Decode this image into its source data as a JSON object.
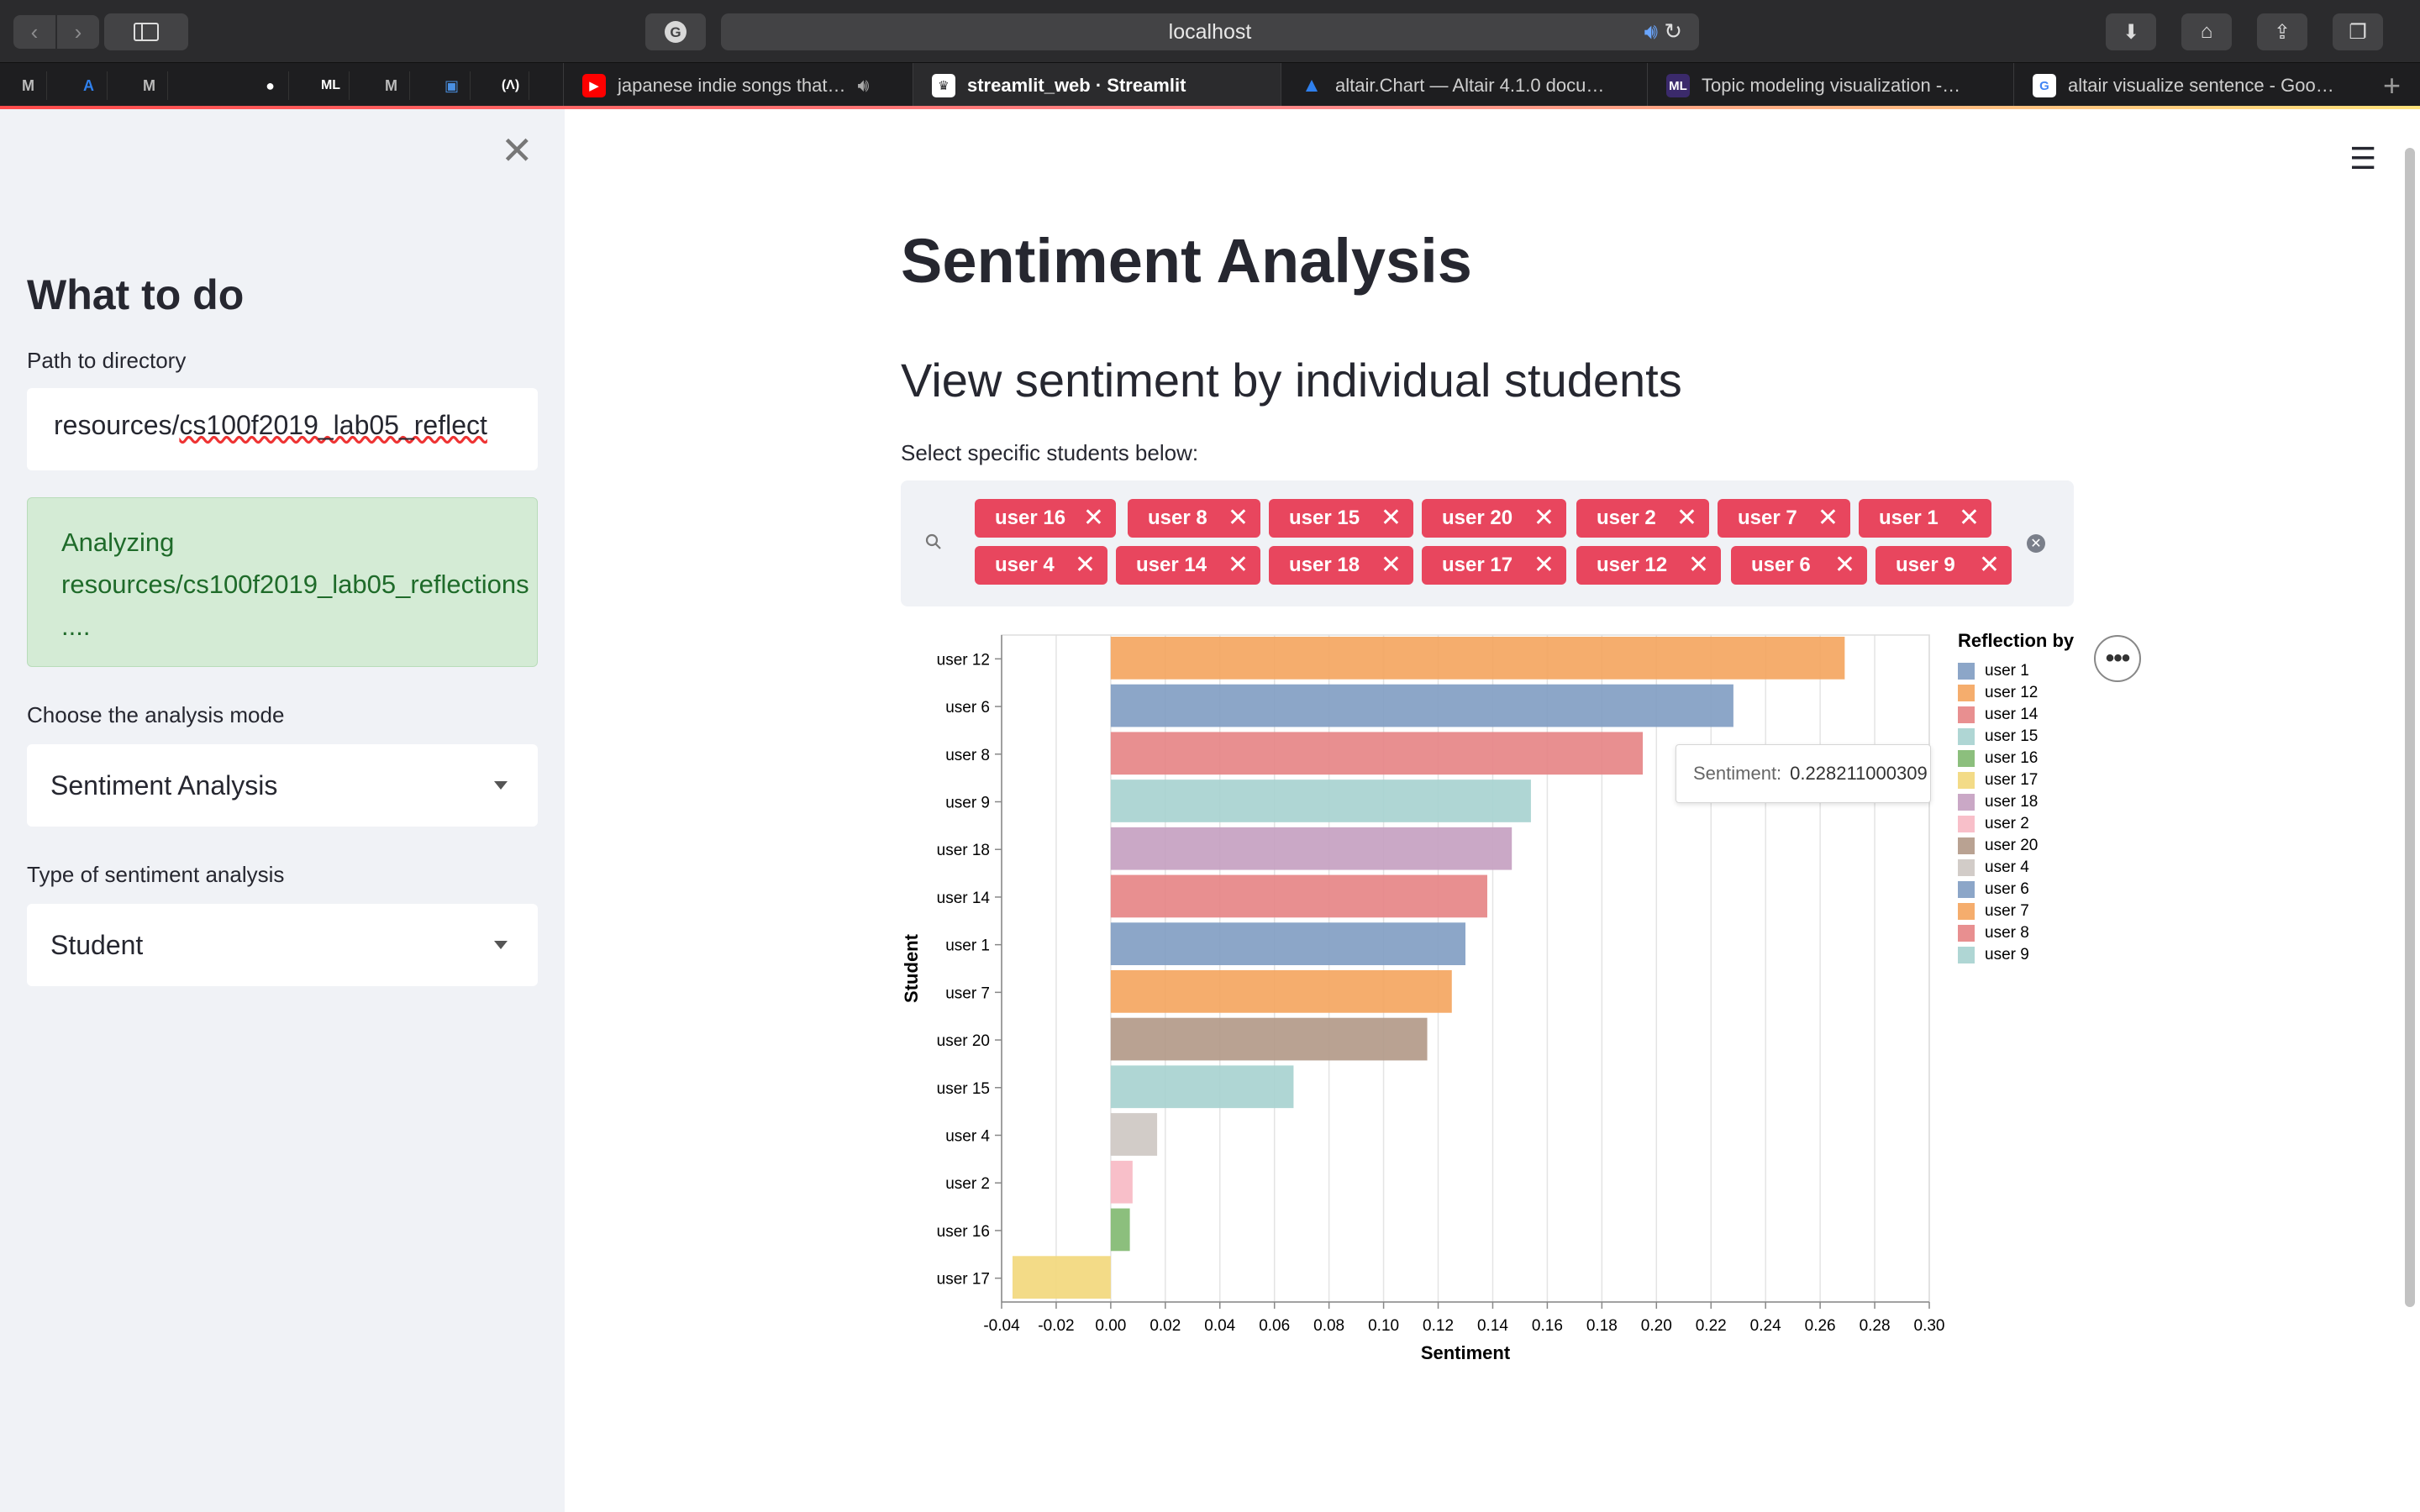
{
  "browser": {
    "url": "localhost",
    "tabs": [
      {
        "title": "japanese indie songs that…",
        "icon": "youtube-icon",
        "color": "#ff0000"
      },
      {
        "title": "streamlit_web · Streamlit",
        "icon": "streamlit-icon",
        "color": "#ff4b4b",
        "active": true
      },
      {
        "title": "altair.Chart — Altair 4.1.0 docu…",
        "icon": "altair-icon",
        "color": "#2f80ed"
      },
      {
        "title": "Topic modeling visualization -…",
        "icon": "ml-icon",
        "color": "#3b2a6b"
      },
      {
        "title": "altair visualize sentence - Goo…",
        "icon": "google-icon",
        "color": "#4285f4"
      }
    ],
    "pinned": [
      "M",
      "A",
      "M",
      "GH",
      "ML",
      "M",
      "B",
      "A"
    ]
  },
  "sidebar": {
    "title": "What to do",
    "path_label": "Path to directory",
    "path_value_a": "resources/",
    "path_value_b": "cs100f2019_lab05_reflect",
    "info_line1": "Analyzing",
    "info_line2": "resources/cs100f2019_lab05_reflections",
    "info_line3": "....",
    "mode_label": "Choose the analysis mode",
    "mode_value": "Sentiment Analysis",
    "type_label": "Type of sentiment analysis",
    "type_value": "Student"
  },
  "main": {
    "title": "Sentiment Analysis",
    "subtitle": "View sentiment by individual students",
    "select_label": "Select specific students below:",
    "chips_row1": [
      "user 16",
      "user 8",
      "user 15",
      "user 20",
      "user 2",
      "user 7",
      "user 1"
    ],
    "chips_row2": [
      "user 4",
      "user 14",
      "user 18",
      "user 17",
      "user 12",
      "user 6",
      "user 9"
    ]
  },
  "tooltip": {
    "key": "Sentiment:",
    "value": "0.228211000309"
  },
  "chart_data": {
    "type": "bar",
    "orientation": "horizontal",
    "xlabel": "Sentiment",
    "ylabel": "Student",
    "xlim": [
      -0.04,
      0.3
    ],
    "xticks": [
      -0.04,
      -0.02,
      0.0,
      0.02,
      0.04,
      0.06,
      0.08,
      0.1,
      0.12,
      0.14,
      0.16,
      0.18,
      0.2,
      0.22,
      0.24,
      0.26,
      0.28,
      0.3
    ],
    "xtick_labels": [
      "-0.04",
      "-0.02",
      "0.00",
      "0.02",
      "0.04",
      "0.06",
      "0.08",
      "0.10",
      "0.12",
      "0.14",
      "0.16",
      "0.18",
      "0.20",
      "0.22",
      "0.24",
      "0.26",
      "0.28",
      "0.30"
    ],
    "grid": true,
    "categories": [
      "user 12",
      "user 6",
      "user 8",
      "user 9",
      "user 18",
      "user 14",
      "user 1",
      "user 7",
      "user 20",
      "user 15",
      "user 4",
      "user 2",
      "user 16",
      "user 17"
    ],
    "values": [
      0.269,
      0.228211000309,
      0.195,
      0.154,
      0.147,
      0.138,
      0.13,
      0.125,
      0.116,
      0.067,
      0.017,
      0.008,
      0.007,
      -0.036
    ],
    "colors": [
      "#f4a45d",
      "#7f9cc2",
      "#e58384",
      "#a6d2cf",
      "#c49ec0",
      "#e58384",
      "#7f9cc2",
      "#f4a45d",
      "#b19886",
      "#a6d2cf",
      "#cdc6c2",
      "#f7b8c3",
      "#80b86f",
      "#f2d77a"
    ],
    "legend_title": "Reflection by",
    "legend_position": "right",
    "legend": [
      {
        "name": "user 1",
        "color": "#7f9cc2"
      },
      {
        "name": "user 12",
        "color": "#f4a45d"
      },
      {
        "name": "user 14",
        "color": "#e58384"
      },
      {
        "name": "user 15",
        "color": "#a6d2cf"
      },
      {
        "name": "user 16",
        "color": "#80b86f"
      },
      {
        "name": "user 17",
        "color": "#f2d77a"
      },
      {
        "name": "user 18",
        "color": "#c49ec0"
      },
      {
        "name": "user 2",
        "color": "#f7b8c3"
      },
      {
        "name": "user 20",
        "color": "#b19886"
      },
      {
        "name": "user 4",
        "color": "#cdc6c2"
      },
      {
        "name": "user 6",
        "color": "#7f9cc2"
      },
      {
        "name": "user 7",
        "color": "#f4a45d"
      },
      {
        "name": "user 8",
        "color": "#e58384"
      },
      {
        "name": "user 9",
        "color": "#a6d2cf"
      }
    ]
  }
}
